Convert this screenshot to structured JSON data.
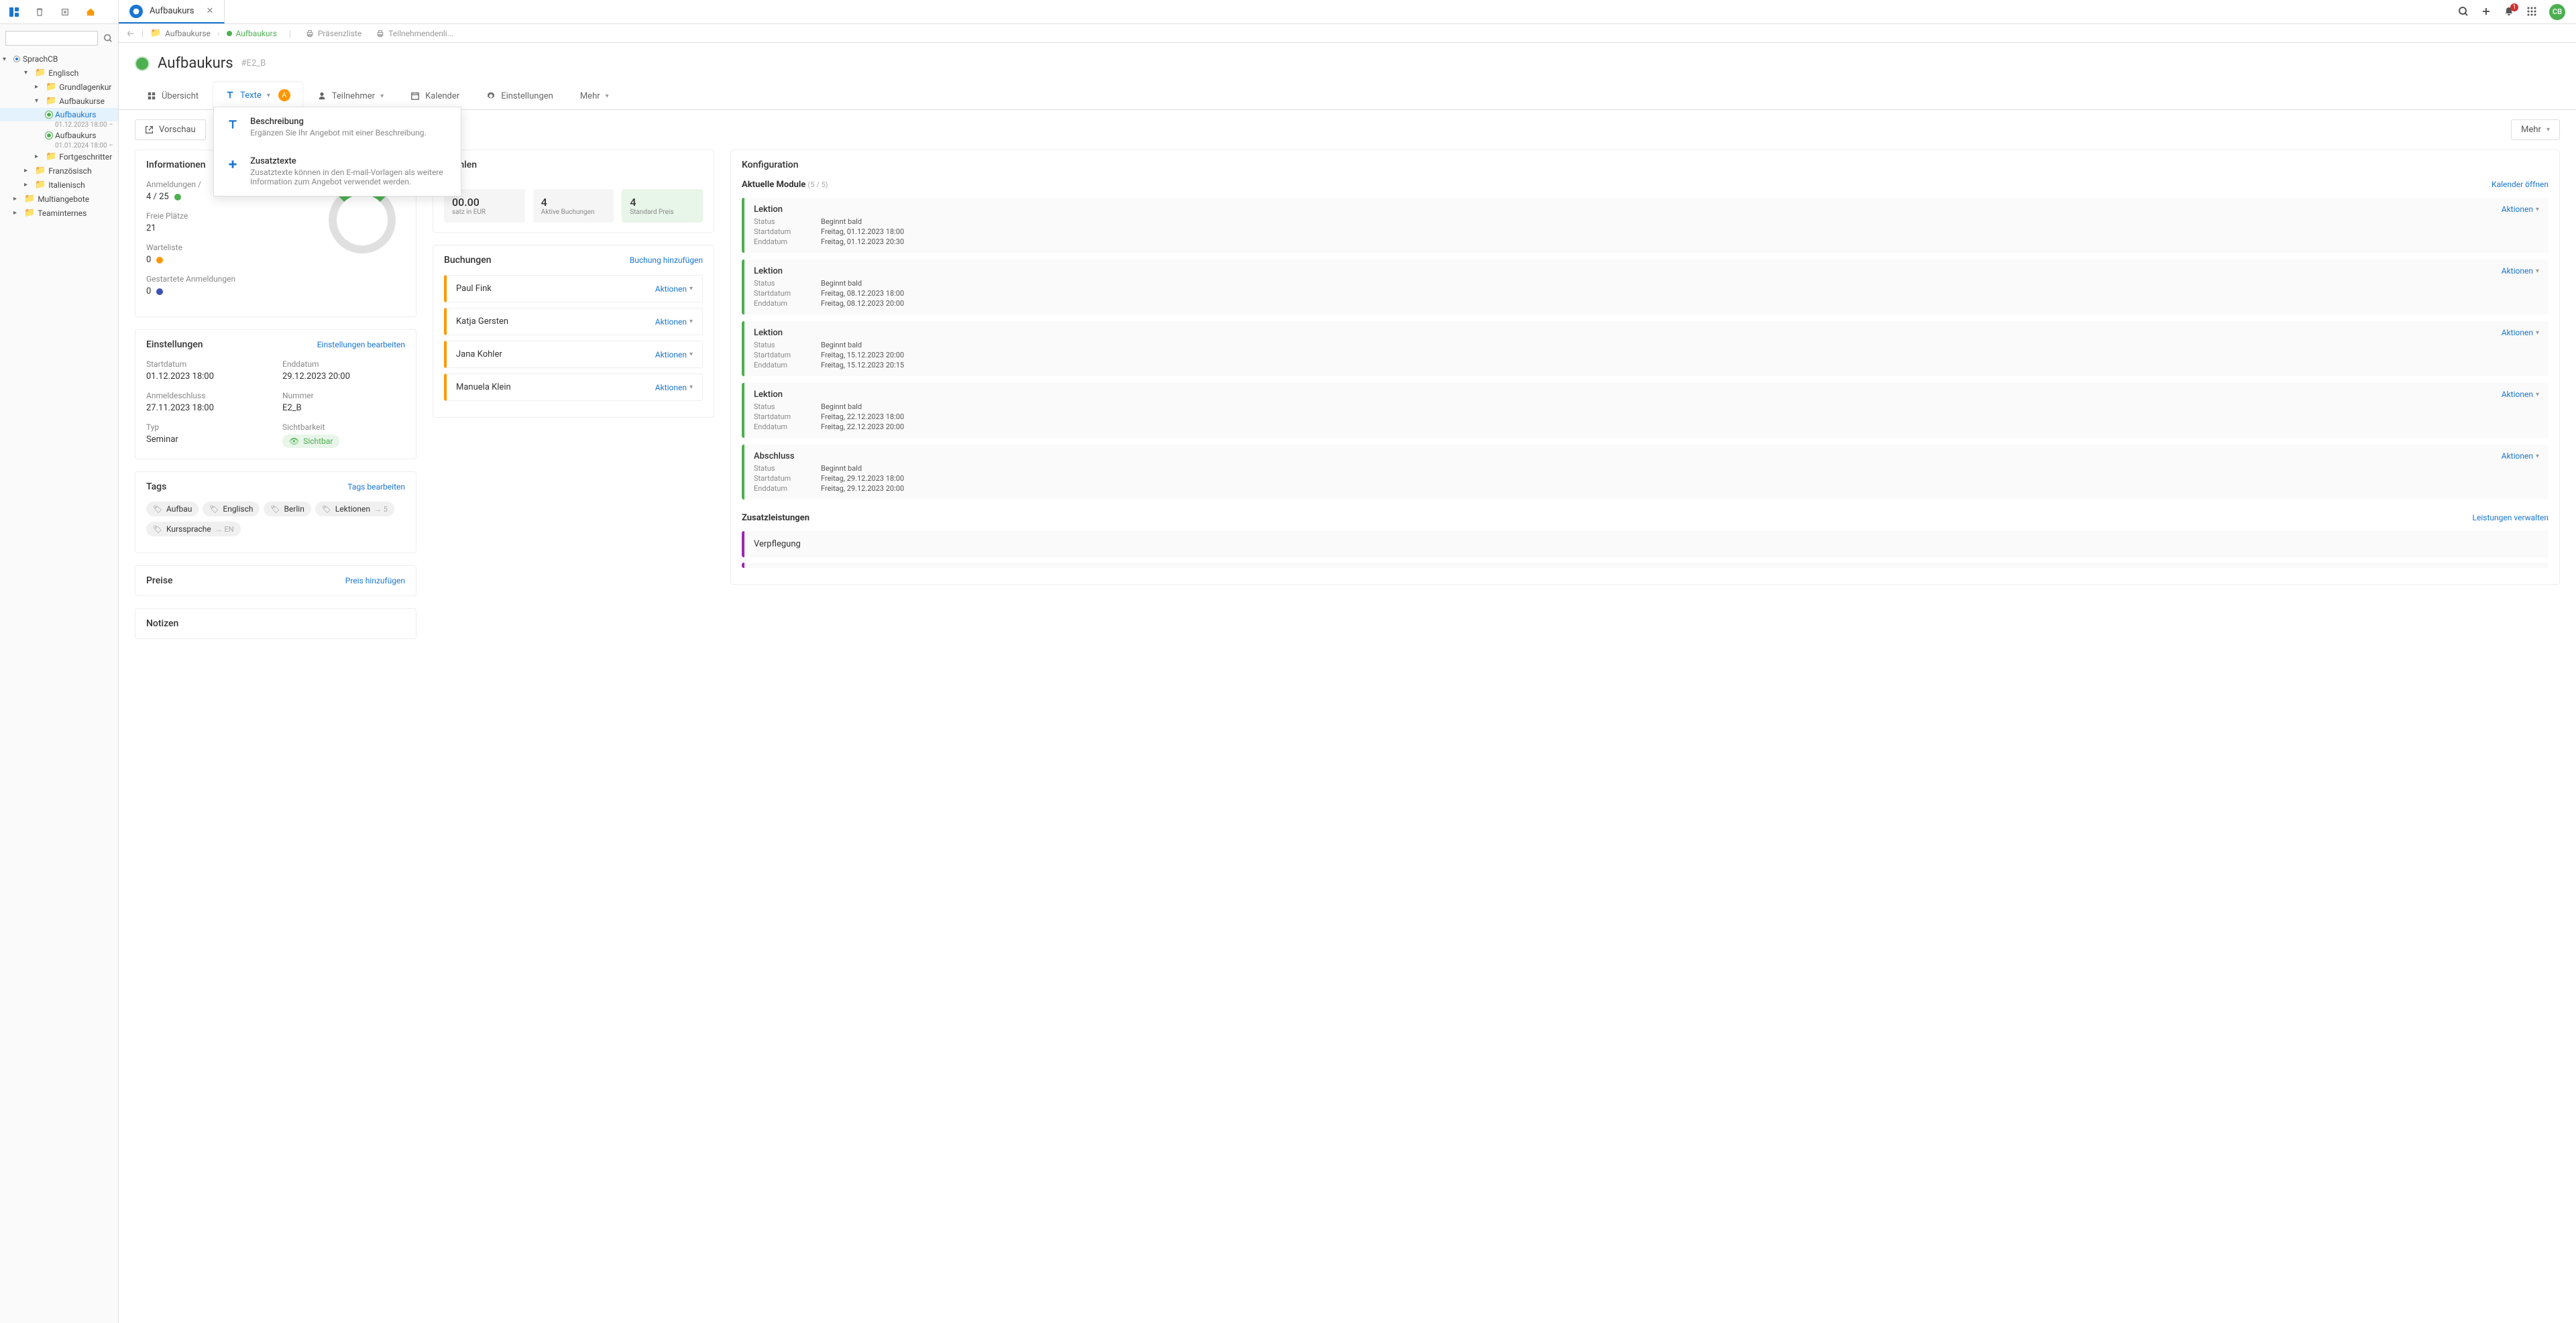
{
  "topbar": {
    "tab_title": "Aufbaukurs",
    "notif_count": "1",
    "avatar_initials": "CB"
  },
  "sidebar": {
    "root": "SprachCB",
    "nodes": [
      {
        "label": "Englisch",
        "indent": 1,
        "expanded": true
      },
      {
        "label": "Grundlagenkur",
        "indent": 2
      },
      {
        "label": "Aufbaukurse",
        "indent": 2,
        "expanded": true
      },
      {
        "label": "Aufbaukurs",
        "indent": 3,
        "leaf": true,
        "active": true,
        "sub": "01.12.2023 18:00 –"
      },
      {
        "label": "Aufbaukurs",
        "indent": 3,
        "leaf": true,
        "sub": "01.01.2024 18:00 –"
      },
      {
        "label": "Fortgeschritter",
        "indent": 2
      },
      {
        "label": "Französisch",
        "indent": 1
      },
      {
        "label": "Italienisch",
        "indent": 1
      },
      {
        "label": "Multiangebote",
        "indent": 0,
        "yellow": true
      },
      {
        "label": "Teaminternes",
        "indent": 0,
        "yellow": true
      }
    ]
  },
  "breadcrumb": {
    "items": [
      "Aufbaukurse",
      "Aufbaukurs"
    ],
    "right_buttons": [
      "Präsenzliste",
      "Teilnehmendenli..."
    ]
  },
  "header": {
    "title": "Aufbaukurs",
    "code": "#E2_B",
    "tabs": {
      "overview": "Übersicht",
      "texts": "Texte",
      "participants": "Teilnehmer",
      "calendar": "Kalender",
      "settings": "Einstellungen",
      "more": "Mehr"
    },
    "text_badge": "A"
  },
  "dropdown": {
    "item1_title": "Beschreibung",
    "item1_sub": "Ergänzen Sie Ihr Angebot mit einer Beschreibung.",
    "item2_title": "Zusatztexte",
    "item2_sub": "Zusatztexte können in den E-mail-Vorlagen als weitere Information zum Angebot verwendet werden."
  },
  "actions": {
    "preview": "Vorschau",
    "more": "Mehr"
  },
  "info": {
    "title": "Informationen",
    "registrations_label": "Anmeldungen /",
    "registrations_value": "4 / 25",
    "free_label": "Freie Plätze",
    "free_value": "21",
    "wait_label": "Warteliste",
    "wait_value": "0",
    "started_label": "Gestartete Anmeldungen",
    "started_value": "0"
  },
  "settings": {
    "title": "Einstellungen",
    "edit": "Einstellungen bearbeiten",
    "start_label": "Startdatum",
    "start_value": "01.12.2023 18:00",
    "end_label": "Enddatum",
    "end_value": "29.12.2023 20:00",
    "deadline_label": "Anmeldeschluss",
    "deadline_value": "27.11.2023 18:00",
    "number_label": "Nummer",
    "number_value": "E2_B",
    "type_label": "Typ",
    "type_value": "Seminar",
    "vis_label": "Sichtbarkeit",
    "vis_value": "Sichtbar"
  },
  "tags": {
    "title": "Tags",
    "edit": "Tags bearbeiten",
    "items": [
      "Aufbau",
      "Englisch",
      "Berlin"
    ],
    "lek_label": "Lektionen",
    "lek_val": "5",
    "lang_label": "Kurssprache",
    "lang_val": "EN"
  },
  "prices": {
    "title": "Preise",
    "add": "Preis hinzufügen"
  },
  "notes": {
    "title": "Notizen"
  },
  "kennzahlen": {
    "title": "nzahlen",
    "s1_num": "00.00",
    "s1_label": "satz in EUR",
    "s2_num": "4",
    "s2_label": "Aktive Buchungen",
    "s3_num": "4",
    "s3_label": "Standard Preis"
  },
  "bookings": {
    "title": "Buchungen",
    "add": "Buchung hinzufügen",
    "action_label": "Aktionen",
    "rows": [
      "Paul Fink",
      "Katja Gersten",
      "Jana Kohler",
      "Manuela Klein"
    ]
  },
  "config": {
    "title": "Konfiguration",
    "mods_title": "Aktuelle Module",
    "mods_count": "(5 / 5)",
    "cal_link": "Kalender öffnen",
    "action_label": "Aktionen",
    "status_label": "Status",
    "start_label": "Startdatum",
    "end_label": "Enddatum",
    "status_value": "Beginnt bald",
    "modules": [
      {
        "title": "Lektion",
        "start": "Freitag, 01.12.2023 18:00",
        "end": "Freitag, 01.12.2023 20:30"
      },
      {
        "title": "Lektion",
        "start": "Freitag, 08.12.2023 18:00",
        "end": "Freitag, 08.12.2023 20:00"
      },
      {
        "title": "Lektion",
        "start": "Freitag, 15.12.2023 20:00",
        "end": "Freitag, 15.12.2023 20:15"
      },
      {
        "title": "Lektion",
        "start": "Freitag, 22.12.2023 18:00",
        "end": "Freitag, 22.12.2023 20:00"
      },
      {
        "title": "Abschluss",
        "start": "Freitag, 29.12.2023 18:00",
        "end": "Freitag, 29.12.2023 20:00"
      }
    ],
    "services_title": "Zusatzleistungen",
    "services_link": "Leistungen verwalten",
    "service1": "Verpflegung"
  }
}
